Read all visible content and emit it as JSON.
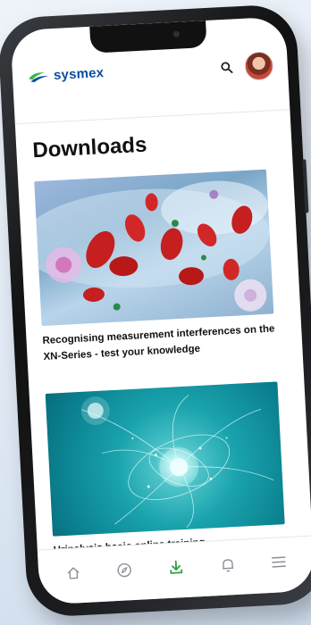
{
  "header": {
    "brand_name": "sysmex",
    "search_icon": "search-icon",
    "avatar_icon": "avatar"
  },
  "page": {
    "title": "Downloads"
  },
  "downloads": [
    {
      "title": "Recognising measurement interferences on the XN-Series - test your knowledge",
      "thumbnail": "blood-cells-illustration"
    },
    {
      "title": "Urinalysis basic online training",
      "thumbnail": "abstract-burst-illustration"
    }
  ],
  "tabbar": {
    "items": [
      {
        "icon": "home-icon",
        "active": false
      },
      {
        "icon": "compass-icon",
        "active": false
      },
      {
        "icon": "download-icon",
        "active": true
      },
      {
        "icon": "bell-icon",
        "active": false
      },
      {
        "icon": "menu-icon",
        "active": false
      }
    ]
  },
  "colors": {
    "brand_blue": "#0a4ea2",
    "brand_green": "#39b54a",
    "active_tab": "#2e9d46",
    "inactive_tab": "#8a8f96"
  }
}
